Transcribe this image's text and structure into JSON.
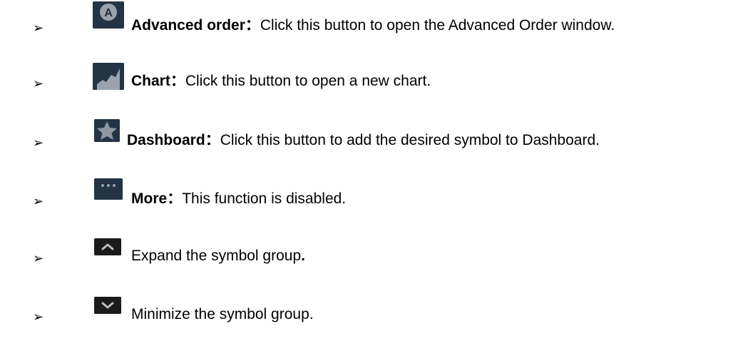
{
  "bullet_glyph": "➢",
  "items": [
    {
      "icon": "advanced-order-icon",
      "icon_letter": "A",
      "label": "Advanced order",
      "separator": "：",
      "description": "Click this button to open the Advanced Order window."
    },
    {
      "icon": "chart-icon",
      "label": "Chart",
      "separator": "：",
      "description": "Click this button to open a new chart."
    },
    {
      "icon": "star-icon",
      "label": "Dashboard",
      "separator": "：",
      "description": "Click this button to add the desired symbol to Dashboard."
    },
    {
      "icon": "more-icon",
      "label": "More",
      "separator": "：",
      "description": "This function is disabled."
    },
    {
      "icon": "chevron-up-icon",
      "description": "Expand the symbol group",
      "suffix": "."
    },
    {
      "icon": "chevron-down-icon",
      "description": "Minimize the symbol group."
    }
  ],
  "colors": {
    "icon_background": "#243447",
    "icon_dark_background": "#1b1b1b",
    "icon_gray": "#9aa3ad",
    "text": "#000000"
  }
}
